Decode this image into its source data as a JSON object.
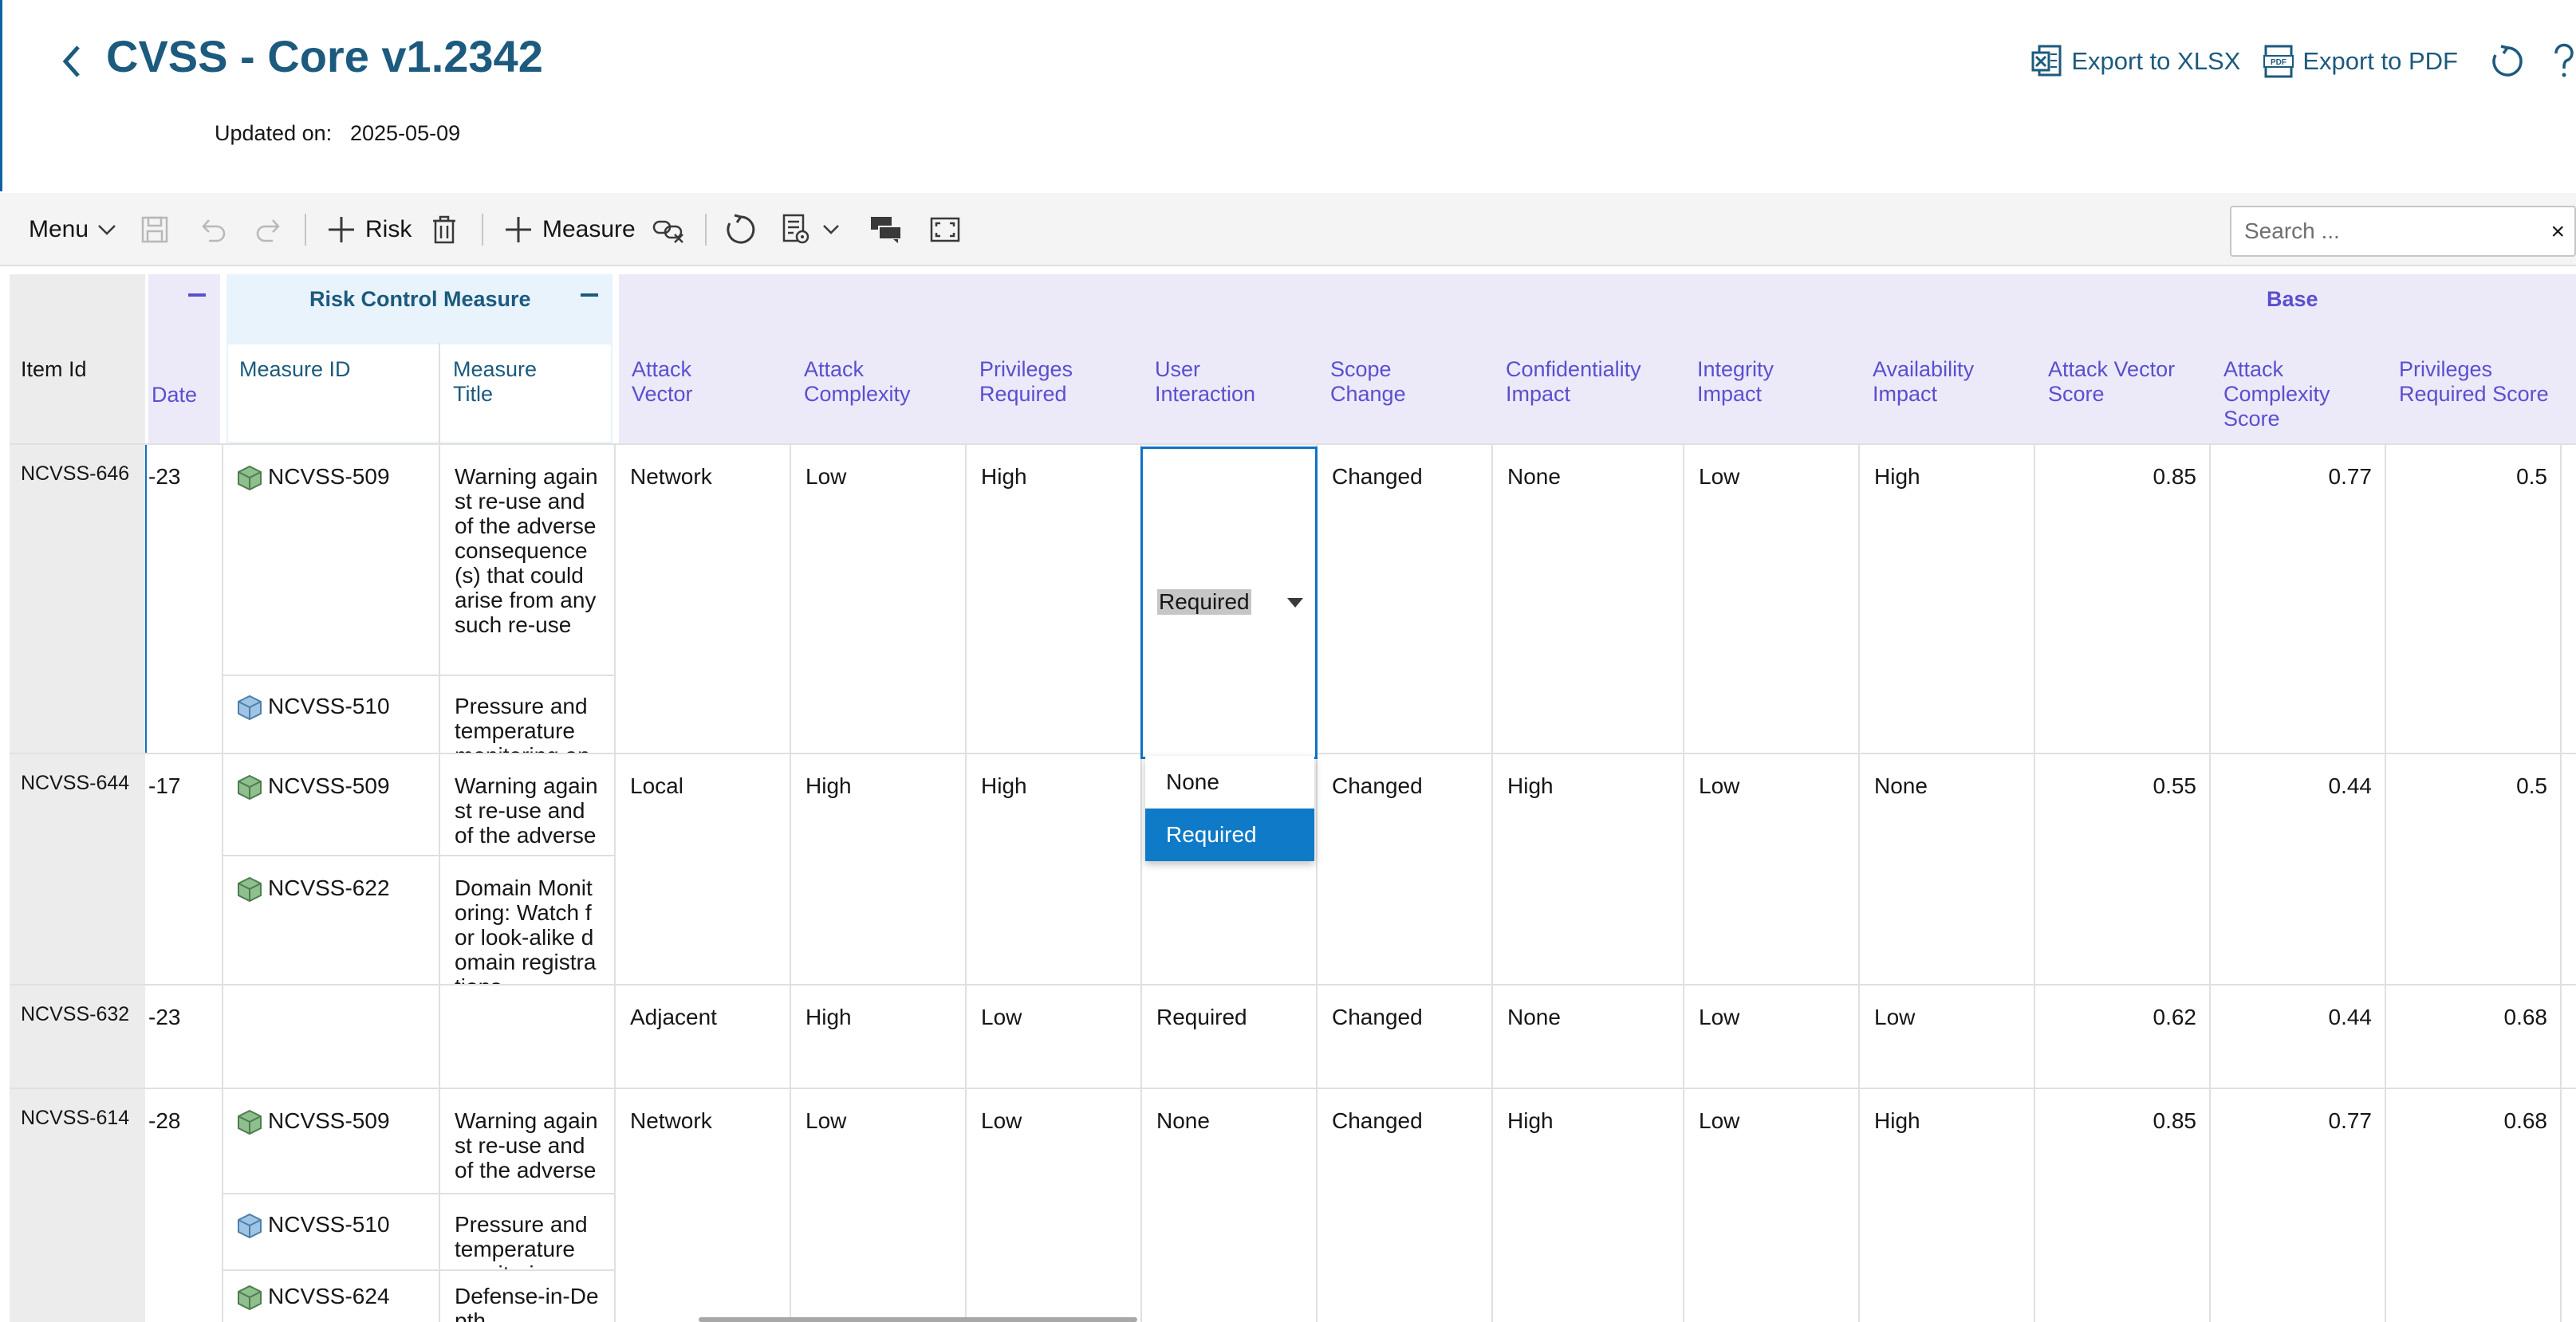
{
  "header": {
    "title": "CVSS - Core v1.2342",
    "updated_label": "Updated on:",
    "updated_value": "2025-05-09",
    "export_xlsx": "Export to XLSX",
    "export_pdf": "Export to PDF"
  },
  "toolbar": {
    "menu": "Menu",
    "risk": "Risk",
    "measure": "Measure",
    "search_placeholder": "Search ...",
    "search_clear": "×"
  },
  "grid": {
    "group_risk_control": "Risk Control Measure",
    "group_base": "Base",
    "columns": {
      "item_id": "Item Id",
      "date": "Date",
      "measure_id": "Measure ID",
      "measure_title": "Measure Title",
      "attack_vector": "Attack Vector",
      "attack_complexity": "Attack Complexity",
      "privileges_required": "Privileges Required",
      "user_interaction": "User Interaction",
      "scope_change": "Scope Change",
      "confidentiality_impact": "Confidentiality Impact",
      "integrity_impact": "Integrity Impact",
      "availability_impact": "Availability Impact",
      "attack_vector_score": "Attack Vector Score",
      "attack_complexity_score": "Attack Complexity Score",
      "privileges_required_score": "Privileges Required Score"
    },
    "rows": [
      {
        "item_id": "NCVSS-646",
        "date": "-23",
        "measures": [
          {
            "id": "NCVSS-509",
            "title": "Warning against re-use and of the adverse consequence(s) that could arise from any such re-use",
            "icon": "cube-green-icon"
          },
          {
            "id": "NCVSS-510",
            "title": "Pressure and temperature monitoring and",
            "icon": "cube-blue-icon"
          }
        ],
        "attack_vector": "Network",
        "attack_complexity": "Low",
        "privileges_required": "High",
        "user_interaction": "Required",
        "scope_change": "Changed",
        "confidentiality_impact": "None",
        "integrity_impact": "Low",
        "availability_impact": "High",
        "attack_vector_score": "0.85",
        "attack_complexity_score": "0.77",
        "privileges_required_score": "0.5"
      },
      {
        "item_id": "NCVSS-644",
        "date": "-17",
        "measures": [
          {
            "id": "NCVSS-509",
            "title": "Warning against re-use and of the adverse",
            "icon": "cube-green-icon"
          },
          {
            "id": "NCVSS-622",
            "title": "Domain Monitoring: Watch for look-alike domain registrations",
            "icon": "cube-green-icon"
          }
        ],
        "attack_vector": "Local",
        "attack_complexity": "High",
        "privileges_required": "High",
        "user_interaction": "",
        "scope_change": "Changed",
        "confidentiality_impact": "High",
        "integrity_impact": "Low",
        "availability_impact": "None",
        "attack_vector_score": "0.55",
        "attack_complexity_score": "0.44",
        "privileges_required_score": "0.5"
      },
      {
        "item_id": "NCVSS-632",
        "date": "-23",
        "measures": [],
        "attack_vector": "Adjacent",
        "attack_complexity": "High",
        "privileges_required": "Low",
        "user_interaction": "Required",
        "scope_change": "Changed",
        "confidentiality_impact": "None",
        "integrity_impact": "Low",
        "availability_impact": "Low",
        "attack_vector_score": "0.62",
        "attack_complexity_score": "0.44",
        "privileges_required_score": "0.68"
      },
      {
        "item_id": "NCVSS-614",
        "date": "-28",
        "measures": [
          {
            "id": "NCVSS-509",
            "title": "Warning against re-use and of the adverse",
            "icon": "cube-green-icon"
          },
          {
            "id": "NCVSS-510",
            "title": "Pressure and temperature monitoring and",
            "icon": "cube-blue-icon"
          },
          {
            "id": "NCVSS-624",
            "title": "Defense-in-Depth",
            "icon": "cube-green-icon"
          }
        ],
        "attack_vector": "Network",
        "attack_complexity": "Low",
        "privileges_required": "Low",
        "user_interaction": "None",
        "scope_change": "Changed",
        "confidentiality_impact": "High",
        "integrity_impact": "Low",
        "availability_impact": "High",
        "attack_vector_score": "0.85",
        "attack_complexity_score": "0.77",
        "privileges_required_score": "0.68"
      }
    ],
    "dropdown": {
      "current": "Required",
      "options": [
        "None",
        "Required"
      ]
    }
  },
  "colors": {
    "title": "#1c5a7e",
    "base_header_bg": "#eceaf9",
    "risk_control_header_bg": "#e8f3fc",
    "selection_blue": "#0f7ac7"
  }
}
